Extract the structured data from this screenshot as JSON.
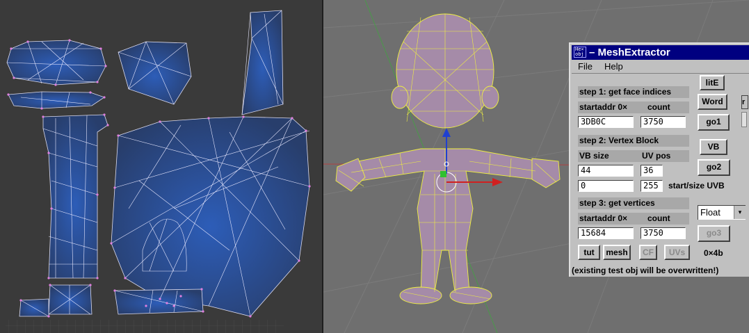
{
  "window": {
    "icon_text_line1": "He×",
    "icon_text_line2": "obj",
    "title": "– MeshExtractor"
  },
  "menu": {
    "file": "File",
    "help": "Help"
  },
  "step1": {
    "label": "step 1: get face indices",
    "startaddr_label": "startaddr 0×",
    "count_label": "count",
    "startaddr_value": "3DB0C",
    "count_value": "3750"
  },
  "step2": {
    "label": "step 2: Vertex Block",
    "vbsize_label": "VB size",
    "uvpos_label": "UV pos",
    "vbsize_value": "44",
    "uvpos_value": "36",
    "start_value": "0",
    "size_value": "255",
    "startsize_label": "start/size UVB"
  },
  "step3": {
    "label": "step 3: get vertices",
    "startaddr_label": "startaddr 0×",
    "count_label": "count",
    "startaddr_value": "15684",
    "count_value": "3750"
  },
  "buttons": {
    "lite": "litE",
    "word": "Word",
    "go1": "go1",
    "vb": "VB",
    "go2": "go2",
    "go3": "go3",
    "tut": "tut",
    "mesh": "mesh",
    "cf": "CF",
    "uvs": "UVs",
    "side_stub": "r"
  },
  "format_select": {
    "value": "Float",
    "arrow": "▾"
  },
  "hex_readout": "0×4b",
  "status_text": "(existing test obj will be overwritten!)",
  "colors": {
    "titlebar": "#000080",
    "window_bg": "#c0c0c0",
    "uv_face": "#2c4a86",
    "uv_vertex": "#e080e0",
    "mesh_wire": "#f0f040",
    "viewport_bg": "#6f6f6f"
  }
}
